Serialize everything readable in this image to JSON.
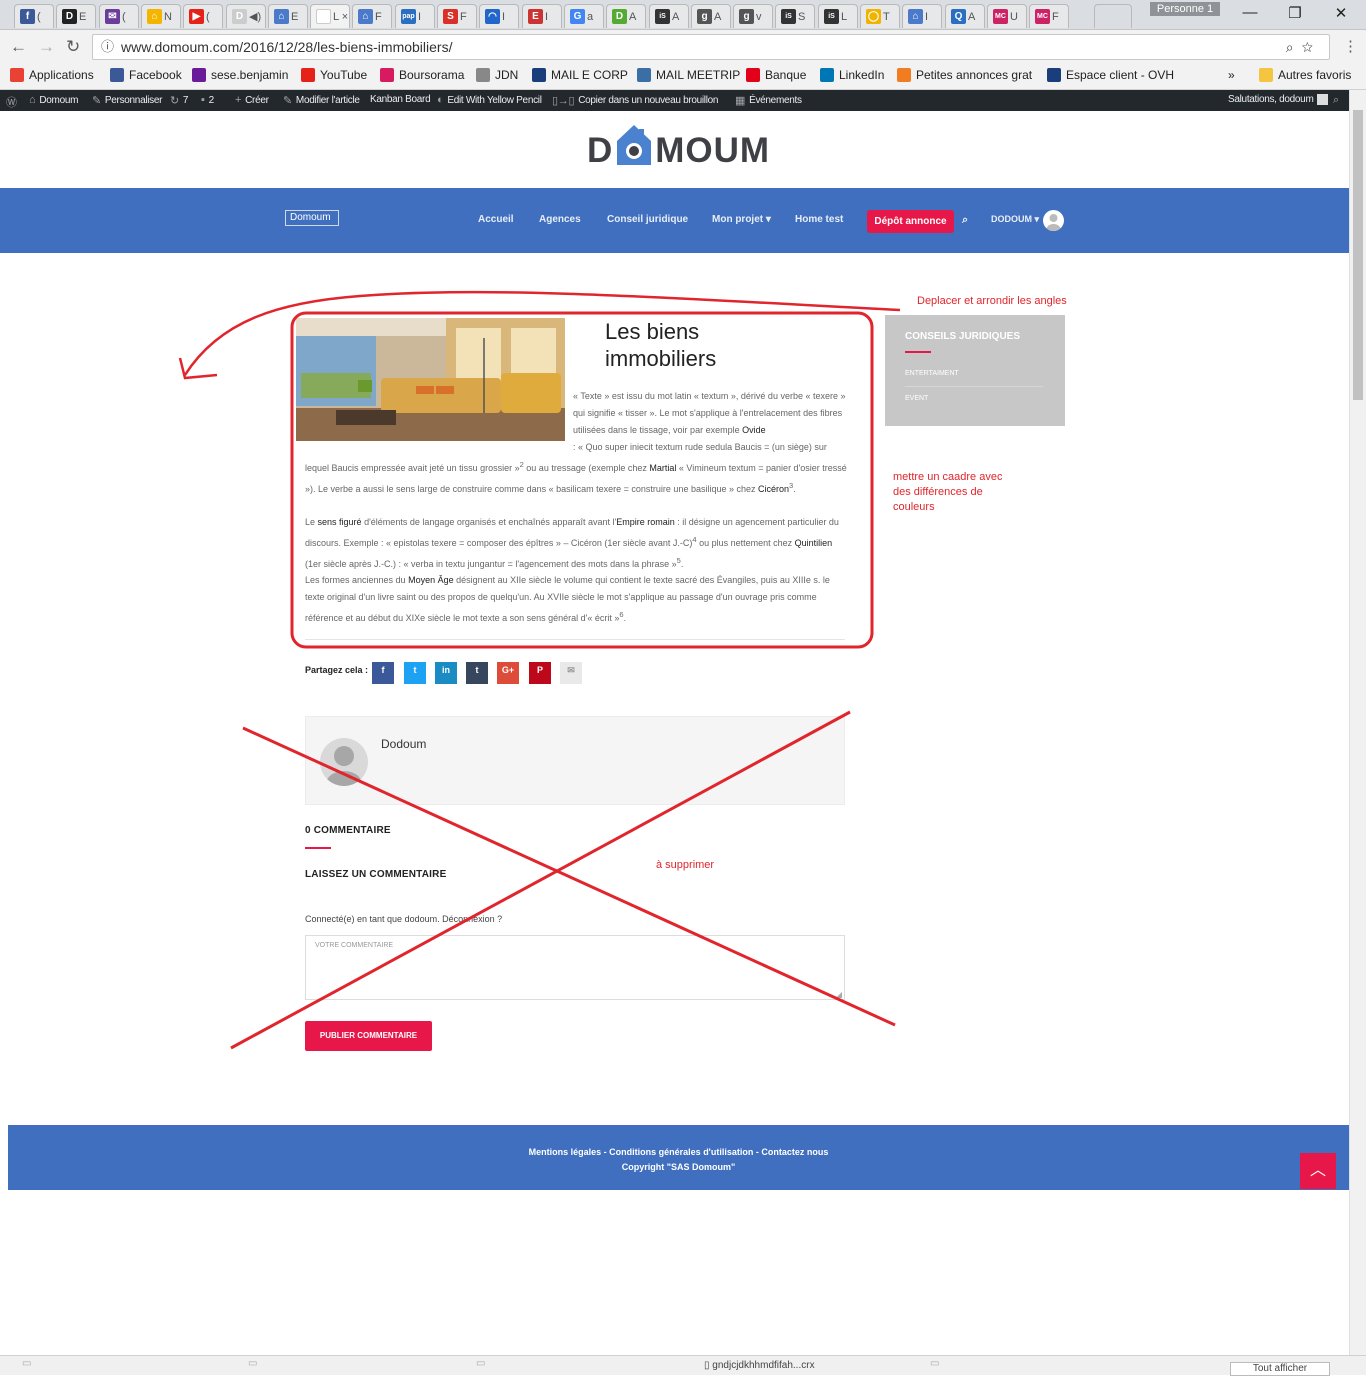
{
  "browser": {
    "person_label": "Personne 1",
    "tabs": [
      {
        "glyph": "f",
        "color": "#3b5998",
        "label": "("
      },
      {
        "glyph": "D",
        "color": "#222222",
        "label": "E"
      },
      {
        "glyph": "✉",
        "color": "#6a3d9a",
        "label": "("
      },
      {
        "glyph": "⌂",
        "color": "#f5b400",
        "label": "N"
      },
      {
        "glyph": "▶",
        "color": "#e62117",
        "label": "("
      },
      {
        "glyph": "D",
        "color": "#cccccc",
        "label": "◀)"
      },
      {
        "glyph": "⌂",
        "color": "#4a7ac9",
        "label": "E"
      },
      {
        "glyph": "",
        "color": "#ffffff",
        "label": "L ×"
      },
      {
        "glyph": "⌂",
        "color": "#4a7ac9",
        "label": "F"
      },
      {
        "glyph": "pap",
        "color": "#2a6fc2",
        "label": "I"
      },
      {
        "glyph": "S",
        "color": "#d9302a",
        "label": "F"
      },
      {
        "glyph": "◠",
        "color": "#2266cc",
        "label": "I"
      },
      {
        "glyph": "E",
        "color": "#cc3333",
        "label": "I"
      },
      {
        "glyph": "G",
        "color": "#4285f4",
        "label": "a"
      },
      {
        "glyph": "D",
        "color": "#55aa33",
        "label": "A"
      },
      {
        "glyph": "iS",
        "color": "#333333",
        "label": "A"
      },
      {
        "glyph": "g",
        "color": "#555555",
        "label": "A"
      },
      {
        "glyph": "g",
        "color": "#555555",
        "label": "v"
      },
      {
        "glyph": "iS",
        "color": "#333333",
        "label": "S"
      },
      {
        "glyph": "iS",
        "color": "#333333",
        "label": "L"
      },
      {
        "glyph": "◯",
        "color": "#f0b400",
        "label": "T"
      },
      {
        "glyph": "⌂",
        "color": "#4a7ac9",
        "label": "I"
      },
      {
        "glyph": "Q",
        "color": "#2a6fc2",
        "label": "A"
      },
      {
        "glyph": "MC",
        "color": "#cc2266",
        "label": "U"
      },
      {
        "glyph": "MC",
        "color": "#cc2266",
        "label": "F"
      }
    ],
    "url": "www.domoum.com/2016/12/28/les-biens-immobiliers/",
    "bookmarks": [
      {
        "label": "Applications",
        "icon": "apps-grid-icon",
        "color": "#e94235"
      },
      {
        "label": "Facebook",
        "icon": "facebook-icon",
        "color": "#3b5998"
      },
      {
        "label": "sese.benjamin",
        "icon": "mail-icon",
        "color": "#6a1b9a"
      },
      {
        "label": "YouTube",
        "icon": "youtube-icon",
        "color": "#e62117"
      },
      {
        "label": "Boursorama",
        "icon": "boursorama-icon",
        "color": "#d81b60"
      },
      {
        "label": "JDN",
        "icon": "jdn-icon",
        "color": "#888888"
      },
      {
        "label": "MAIL E CORP",
        "icon": "ovh-icon",
        "color": "#1a3d7c"
      },
      {
        "label": "MAIL MEETRIP",
        "icon": "mail-meetrip-icon",
        "color": "#3a6ea5"
      },
      {
        "label": "Banque",
        "icon": "bank-icon",
        "color": "#e2001a"
      },
      {
        "label": "LinkedIn",
        "icon": "linkedin-icon",
        "color": "#0077b5"
      },
      {
        "label": "Petites annonces grat",
        "icon": "box-icon",
        "color": "#f07d22"
      },
      {
        "label": "Espace client - OVH",
        "icon": "ovh-icon",
        "color": "#1a3d7c"
      }
    ],
    "more_bookmarks": "»",
    "other_bookmarks": "Autres favoris"
  },
  "wpbar": {
    "site": "Domoum",
    "customize": "Personnaliser",
    "updates": "7",
    "comments": "2",
    "create": "Créer",
    "edit": "Modifier l'article",
    "kanban": "Kanban Board",
    "yellow_pencil": "Edit With Yellow Pencil",
    "copy": "Copier dans un nouveau brouillon",
    "events": "Événements",
    "greeting": "Salutations, dodoum"
  },
  "site": {
    "logo_text_left": "D",
    "logo_text_right": "MOUM",
    "small_logo_alt": "Domoum",
    "nav": [
      "Accueil",
      "Agences",
      "Conseil juridique",
      "Mon projet",
      "Home test"
    ],
    "nav_dropdown_caret": "▾",
    "cta": "Dépôt annonce",
    "user": "DODOUM"
  },
  "article": {
    "title": "Les biens immobiliers",
    "p1_intro": "« Texte » est issu du mot latin « textum », dérivé du verbe « texere » qui signifie « tisser ». Le mot s'applique à l'entrelacement des fibres utilisées dans le tissage, voir par exemple",
    "p1_link1": "Ovide",
    "p1_after1": ": « Quo super iniecit textum rude sedula Baucis = (un siège) sur lequel Baucis empressée avait jeté un tissu grossier »",
    "sup2": "2",
    "p1_after2": " ou au tressage (exemple chez",
    "p1_link2": "Martial",
    "p1_after3": "« Vimineum textum = panier d'osier tressé »). Le verbe a aussi le sens large de construire comme dans « basilicam texere = construire une basilique » chez",
    "p1_link3": "Cicéron",
    "sup3": "3",
    "p2_a": "Le",
    "p2_link1": "sens figuré",
    "p2_b": "d'éléments de langage organisés et enchaînés apparaît avant l'",
    "p2_link2": "Empire romain",
    "p2_c": ": il désigne un agencement particulier du discours. Exemple : « epistolas texere = composer des épîtres » – Cicéron (1er siècle avant J.-C)",
    "sup4": "4",
    "p2_d": " ou plus nettement chez",
    "p2_link3": "Quintilien",
    "p2_e": "(1er siècle après J.-C.) : « verba in textu jungantur = l'agencement des mots dans la phrase »",
    "sup5": "5",
    "p3_a": "Les formes anciennes du",
    "p3_link1": "Moyen Âge",
    "p3_b": "désignent au XIIe siècle le volume qui contient le texte sacré des Évangiles, puis au XIIIe s. le texte original d'un livre saint ou des propos de quelqu'un. Au XVIIe siècle le mot s'applique au passage d'un ouvrage pris comme référence et au début du XIXe siècle le mot texte a son sens général d'« écrit »",
    "sup6": "6",
    "share_label": "Partagez cela :"
  },
  "sidebar": {
    "title": "CONSEILS JURIDIQUES",
    "items": [
      "ENTERTAIMENT",
      "EVENT"
    ]
  },
  "author": {
    "name": "Dodoum"
  },
  "comments": {
    "count_title": "0 COMMENTAIRE",
    "leave_title": "LAISSEZ UN COMMENTAIRE",
    "logged_in": "Connecté(e) en tant que dodoum. Déconnexion ?",
    "placeholder": "VOTRE COMMENTAIRE",
    "publish": "PUBLIER COMMENTAIRE"
  },
  "footer": {
    "links": "Mentions légales - Conditions générales d'utilisation - Contactez nous",
    "copyright": "Copyright \"SAS Domoum\""
  },
  "annotations": {
    "move": "Deplacer et arrondir les angles",
    "frame": "mettre un caadre avec des différences de couleurs",
    "delete": "à supprimer"
  },
  "downloads": {
    "file": "gndjcjdkhhmdfifah...crx",
    "show_all": "Tout afficher"
  },
  "colors": {
    "brand_blue": "#3f6fbe",
    "accent": "#e8174a",
    "annotation_red": "#e0252c"
  }
}
